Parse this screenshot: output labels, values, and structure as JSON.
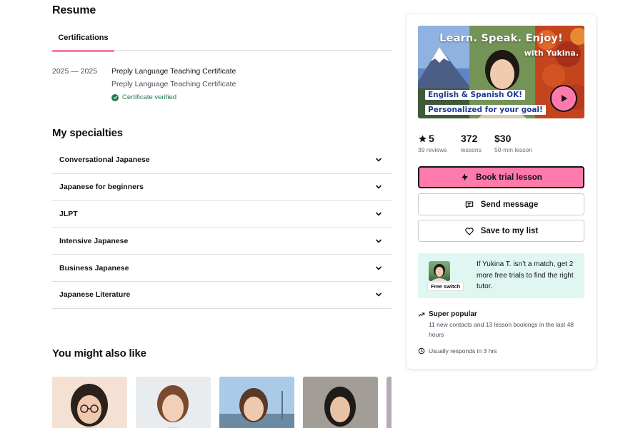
{
  "resume": {
    "title": "Resume",
    "tabs": [
      {
        "label": "Certifications"
      }
    ],
    "certifications": [
      {
        "years": "2025 — 2025",
        "name": "Preply Language Teaching Certificate",
        "description": "Preply Language Teaching Certificate",
        "verified_label": "Certificate verified"
      }
    ]
  },
  "specialties": {
    "title": "My specialties",
    "items": [
      {
        "label": "Conversational Japanese"
      },
      {
        "label": "Japanese for beginners"
      },
      {
        "label": "JLPT"
      },
      {
        "label": "Intensive Japanese"
      },
      {
        "label": "Business Japanese"
      },
      {
        "label": "Japanese Literature"
      }
    ]
  },
  "recommendations": {
    "title": "You might also like"
  },
  "tutor_card": {
    "video": {
      "title": "Learn. Speak. Enjoy!",
      "subtitle": "with Yukina.",
      "tag1": "English & Spanish OK!",
      "tag2": "Personalized for your goal!",
      "play_icon": "play-icon"
    },
    "stats": [
      {
        "value": "5",
        "label": "39 reviews",
        "icon": "star-icon"
      },
      {
        "value": "372",
        "label": "lessons"
      },
      {
        "value": "$30",
        "label": "50-min lesson"
      }
    ],
    "buttons": {
      "book": "Book trial lesson",
      "message": "Send message",
      "save": "Save to my list"
    },
    "free_switch": {
      "badge": "Free switch",
      "text": "If Yukina T. isn’t a match, get 2 more free trials to find the right tutor."
    },
    "popular": {
      "title": "Super popular",
      "description": "11 new contacts and 13 lesson bookings in the last 48 hours"
    },
    "responds": "Usually responds in 3 hrs"
  },
  "colors": {
    "accent_pink": "#ff7aac",
    "verified_green": "#1f7a4d",
    "switch_bg": "#dff7f0",
    "tag_blue": "#1f3a93"
  }
}
